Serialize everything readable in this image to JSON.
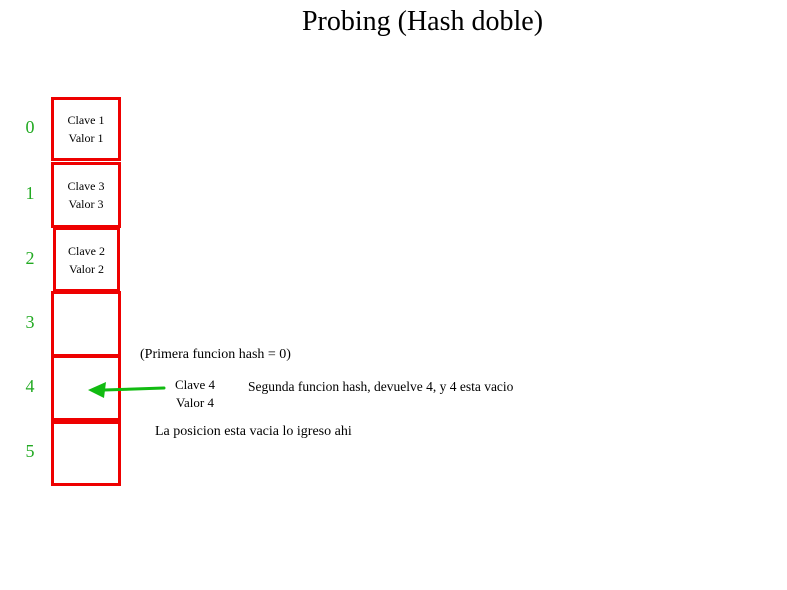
{
  "title": "Probing (Hash doble)",
  "colors": {
    "cell_border": "#ee0000",
    "index_text": "#22aa22",
    "arrow": "#11bb11"
  },
  "table": {
    "indices": [
      "0",
      "1",
      "2",
      "3",
      "4",
      "5"
    ],
    "cells": [
      {
        "key": "Clave 1",
        "value": "Valor 1"
      },
      {
        "key": "Clave 3",
        "value": "Valor 3"
      },
      {
        "key": "Clave 2",
        "value": "Valor 2"
      },
      {
        "key": "",
        "value": ""
      },
      {
        "key": "",
        "value": ""
      },
      {
        "key": "",
        "value": ""
      }
    ]
  },
  "new_entry": {
    "key": "Clave 4",
    "value": "Valor 4"
  },
  "notes": {
    "first_hash": "(Primera funcion hash = 0)",
    "second_hash": "Segunda funcion hash, devuelve 4, y 4 esta vacio",
    "insert": "La posicion  esta vacia lo igreso ahi"
  }
}
